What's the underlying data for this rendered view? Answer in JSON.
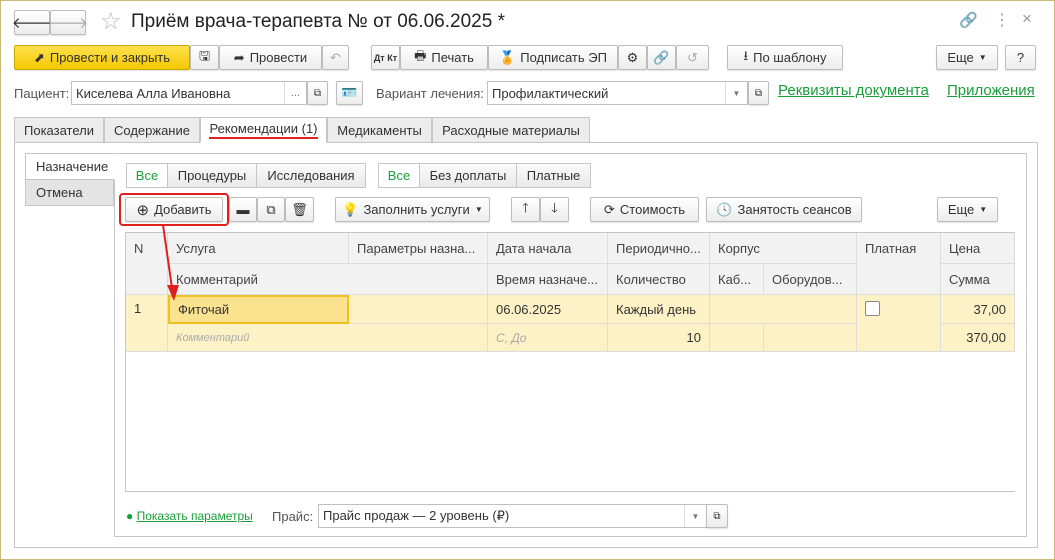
{
  "window": {
    "title": "Приём врача-терапевта №  от 06.06.2025 *",
    "link_icon": "link-icon",
    "more_icon": "⋮",
    "close": "×"
  },
  "toolbar": {
    "post_close": "Провести и закрыть",
    "post": "Провести",
    "dtkt": "Дт Кт",
    "print": "Печать",
    "sign": "Подписать ЭП",
    "template": "По шаблону",
    "more": "Еще",
    "help": "?"
  },
  "header": {
    "patient_label": "Пациент:",
    "patient": "Киселева Алла Ивановна",
    "patient_dots": "...",
    "variant_label": "Вариант лечения:",
    "variant": "Профилактический",
    "link_requisites": "Реквизиты документа",
    "link_attachments": "Приложения"
  },
  "tabs": [
    "Показатели",
    "Содержание",
    "Рекомендации (1)",
    "Медикаменты",
    "Расходные материалы"
  ],
  "side_tabs": [
    "Назначение",
    "Отмена"
  ],
  "filters1": [
    "Все",
    "Процедуры",
    "Исследования"
  ],
  "filters2": [
    "Все",
    "Без доплаты",
    "Платные"
  ],
  "actions": {
    "add": "Добавить",
    "fill": "Заполнить услуги",
    "cost": "Стоимость",
    "sessions": "Занятость сеансов",
    "more": "Еще"
  },
  "table": {
    "headers1": [
      "N",
      "Услуга",
      "Параметры назна...",
      "Дата начала",
      "Периодично...",
      "Корпус",
      "Платная",
      "Цена"
    ],
    "headers2": [
      "Комментарий",
      "Время назначе...",
      "Количество",
      "Каб...",
      "Оборудов...",
      "Сумма"
    ],
    "rows": [
      {
        "n": "1",
        "service": "Фиточай",
        "params": "",
        "date": "06.06.2025",
        "period": "Каждый день",
        "paid": false,
        "price": "37,00",
        "comment": "Комментарий",
        "time": "С, До",
        "qty": "10",
        "sum": "370,00"
      }
    ]
  },
  "footer": {
    "show_params": "Показать параметры",
    "price_label": "Прайс:",
    "price": "Прайс продаж — 2 уровень (₽)"
  }
}
